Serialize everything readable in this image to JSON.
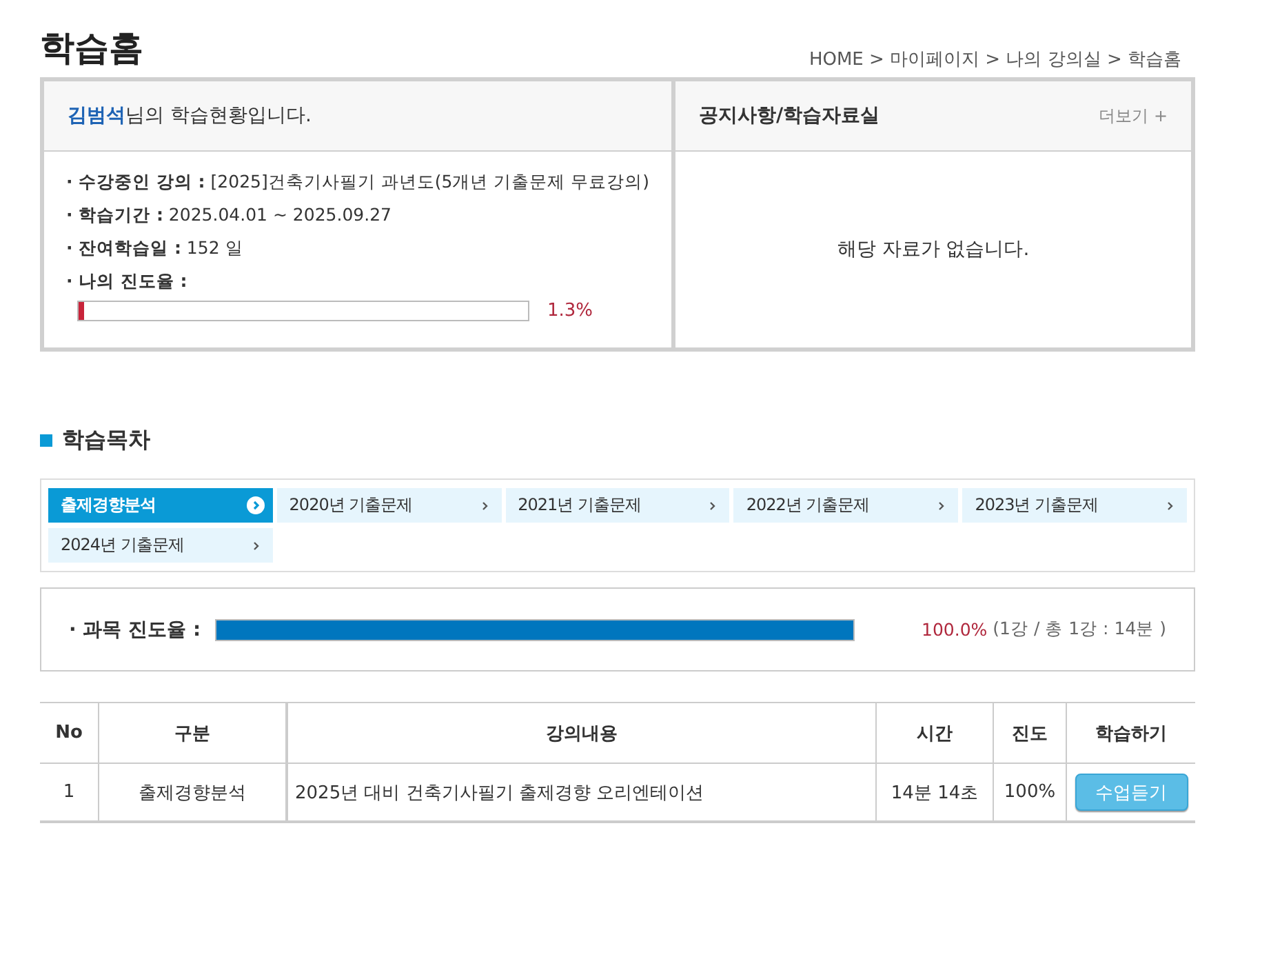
{
  "page_title": "학습홈",
  "breadcrumb": "HOME > 마이페이지 > 나의 강의실 > 학습홈",
  "status_panel": {
    "greeting": "**김범석**님의 학습현황입니다.",
    "items": [
      "**· 수강중인 강의 :** [2025]건축기사필기 과년도(5개년 기출문제 무료강의)",
      "**· 학습기간 :** 2025.04.01 ~ 2025.09.27",
      "**· 잔여학습일 :** 152 일",
      "**· 나의 진도율 :**"
    ],
    "progress": {
      "level": 0.013,
      "reading": "1.3%"
    }
  },
  "notice_panel": {
    "title": "공지사항/학습자료실",
    "more": "더보기 +",
    "empty": "해당 자료가 없습니다."
  },
  "section_title": "학습목차",
  "tabs": [
    {
      "label": "출제경향분석",
      "selected": true
    },
    {
      "label": "2020년 기출문제",
      "selected": false
    },
    {
      "label": "2021년 기출문제",
      "selected": false
    },
    {
      "label": "2022년 기출문제",
      "selected": false
    },
    {
      "label": "2023년 기출문제",
      "selected": false
    },
    {
      "label": "2024년 기출문제",
      "selected": false
    }
  ],
  "subject_progress": {
    "label": "· 과목 진도율 :",
    "level": 1.0,
    "reading": "100.0%",
    "detail": "(1강 / 총 1강 : 14분 )"
  },
  "table": {
    "columns": [
      "No",
      "구분",
      "강의내용",
      "시간",
      "진도",
      "학습하기"
    ],
    "rows": [
      {
        "no": "1",
        "category": "출제경향분석",
        "title": "2025년 대비 건축기사필기 출제경향 오리엔테이션",
        "time": "14분 14초",
        "progress": "100%",
        "action": "수업듣기"
      }
    ]
  }
}
